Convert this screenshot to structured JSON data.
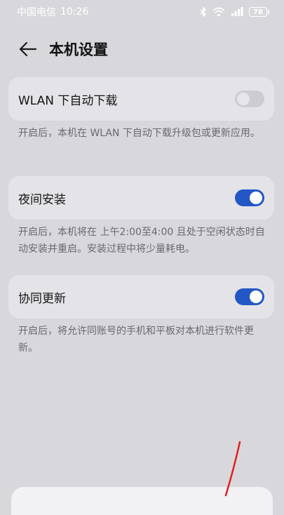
{
  "status_bar": {
    "carrier": "中国电信",
    "time": "10:26",
    "battery": "78"
  },
  "header": {
    "title": "本机设置"
  },
  "settings": [
    {
      "label": "WLAN 下自动下载",
      "enabled": false,
      "description": "开启后，本机在 WLAN 下自动下载升级包或更新应用。"
    },
    {
      "label": "夜间安装",
      "enabled": true,
      "description": "开启后，本机将在 上午2:00至4:00 且处于空闲状态时自动安装并重启。安装过程中将少量耗电。"
    },
    {
      "label": "协同更新",
      "enabled": true,
      "description": "开启后，将允许同账号的手机和平板对本机进行软件更新。"
    }
  ],
  "colors": {
    "background": "#d8d8dc",
    "card": "#e4e4e8",
    "accent": "#2357c6",
    "annotation": "#e02020"
  }
}
